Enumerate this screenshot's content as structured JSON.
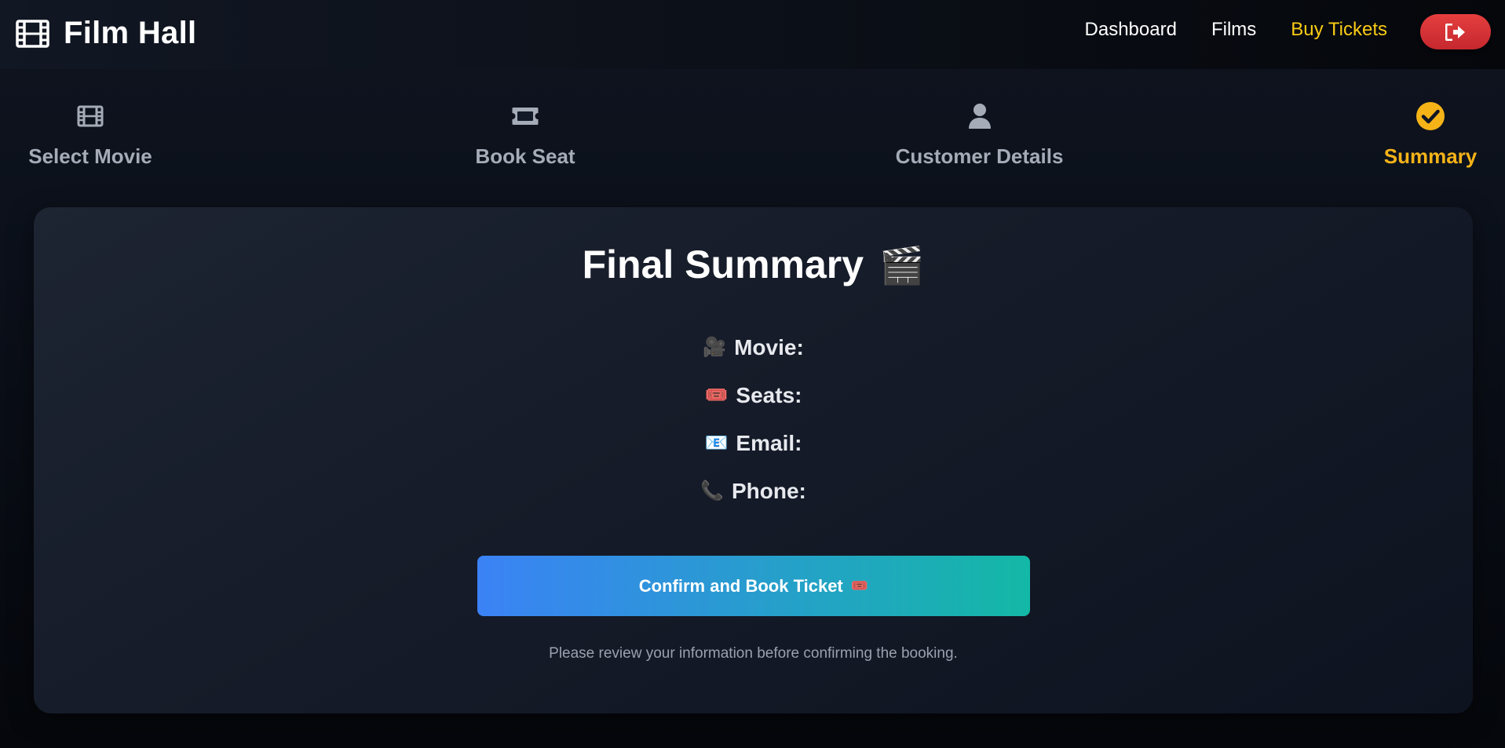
{
  "header": {
    "brand_title": "Film Hall",
    "brand_icon": "film-icon",
    "nav": [
      {
        "label": "Dashboard"
      },
      {
        "label": "Films"
      },
      {
        "label": "Buy Tickets"
      }
    ],
    "active_nav": "Buy Tickets",
    "logout_icon": "sign-out-icon",
    "colors": {
      "active_link": "#facc15",
      "logout_button": "#e53e3e"
    }
  },
  "stepper": {
    "steps": [
      {
        "label": "Select Movie",
        "icon": "film-icon"
      },
      {
        "label": "Book Seat",
        "icon": "ticket-icon"
      },
      {
        "label": "Customer Details",
        "icon": "user-icon"
      },
      {
        "label": "Summary",
        "icon": "check-circle-icon"
      }
    ],
    "active_step": "Summary",
    "colors": {
      "active": "#f5b318",
      "inactive": "#a5acb8"
    }
  },
  "summary": {
    "title": "Final Summary",
    "title_emoji": "🎬",
    "fields": [
      {
        "emoji": "🎥",
        "label": "Movie:",
        "value": ""
      },
      {
        "emoji": "🎟️",
        "label": "Seats:",
        "value": ""
      },
      {
        "emoji": "📧",
        "label": "Email:",
        "value": ""
      },
      {
        "emoji": "📞",
        "label": "Phone:",
        "value": ""
      }
    ],
    "confirm_button": {
      "label": "Confirm and Book Ticket",
      "emoji": "🎟️"
    },
    "helper_text": "Please review your information before confirming the booking.",
    "colors": {
      "button_start": "#3b82f6",
      "button_end": "#14b8a6"
    }
  }
}
